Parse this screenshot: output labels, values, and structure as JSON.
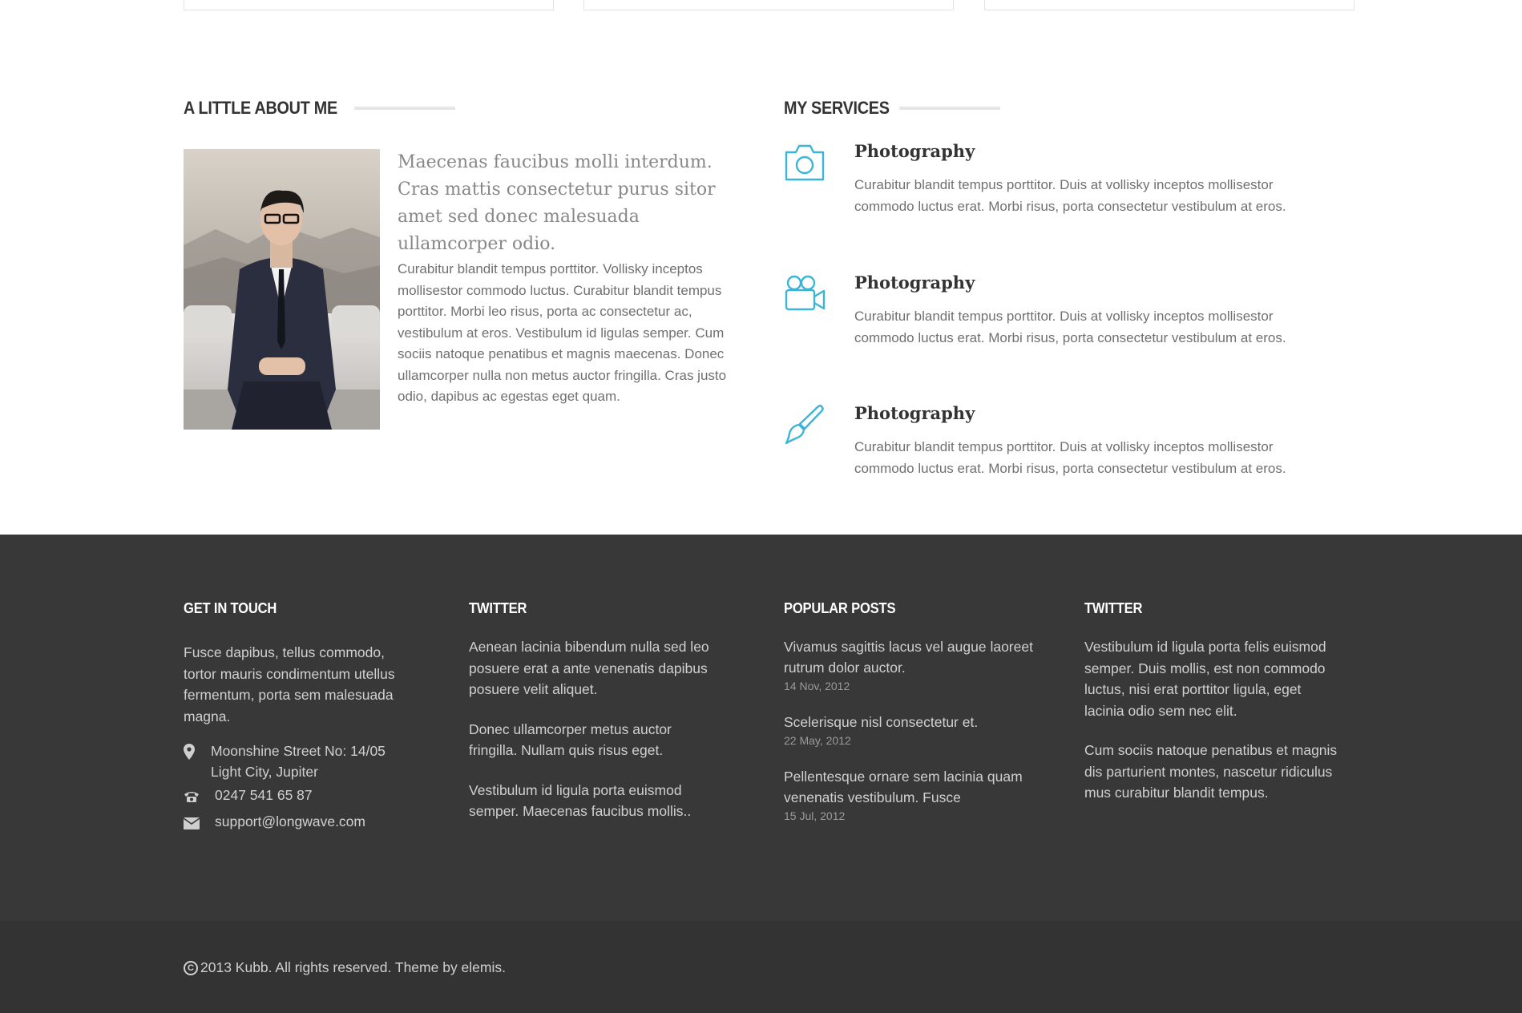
{
  "about": {
    "heading": "A LITTLE ABOUT ME",
    "lead": "Maecenas faucibus molli interdum. Cras mattis consectetur purus sitor amet sed donec malesuada ullamcorper odio.",
    "body": "Curabitur blandit tempus porttitor. Vollisky inceptos mollisestor commodo luctus. Curabitur blandit tempus porttitor. Morbi leo risus, porta ac consectetur ac, vestibulum at eros. Vestibulum id ligulas semper. Cum sociis natoque penatibus et magnis maecenas. Donec ullamcorper nulla non metus auctor fringilla. Cras justo odio, dapibus ac egestas eget quam."
  },
  "services": {
    "heading": "MY SERVICES",
    "accent_color": "#3cb4d8",
    "items": [
      {
        "icon": "camera-icon",
        "title": "Photography",
        "text": "Curabitur blandit tempus porttitor. Duis at vollisky inceptos mollisestor commodo luctus erat. Morbi risus, porta consectetur vestibulum at eros."
      },
      {
        "icon": "video-camera-icon",
        "title": "Photography",
        "text": "Curabitur blandit tempus porttitor. Duis at vollisky inceptos mollisestor commodo luctus erat. Morbi risus, porta consectetur vestibulum at eros."
      },
      {
        "icon": "paint-brush-icon",
        "title": "Photography",
        "text": "Curabitur blandit tempus porttitor. Duis at vollisky inceptos mollisestor commodo luctus erat. Morbi risus, porta consectetur vestibulum at eros."
      }
    ]
  },
  "footer": {
    "contact": {
      "heading": "GET IN TOUCH",
      "intro": "Fusce dapibus, tellus commodo, tortor mauris condimentum utellus fermentum, porta sem malesuada magna.",
      "address_line1": "Moonshine Street No: 14/05",
      "address_line2": "Light City, Jupiter",
      "phone": "0247 541 65 87",
      "email": "support@longwave.com"
    },
    "twitter1": {
      "heading": "TWITTER",
      "tweets": [
        "Aenean lacinia bibendum nulla sed leo posuere erat a ante venenatis dapibus posuere velit aliquet.",
        "Donec ullamcorper metus auctor fringilla. Nullam quis risus eget.",
        "Vestibulum id ligula porta euismod semper. Maecenas faucibus mollis.."
      ]
    },
    "posts": {
      "heading": "POPULAR POSTS",
      "items": [
        {
          "title": "Vivamus sagittis lacus vel augue laoreet rutrum dolor auctor.",
          "date": "14 Nov, 2012"
        },
        {
          "title": "Scelerisque nisl consectetur et.",
          "date": "22 May, 2012"
        },
        {
          "title": "Pellentesque ornare sem lacinia quam venenatis vestibulum. Fusce",
          "date": "15 Jul, 2012"
        }
      ]
    },
    "twitter2": {
      "heading": "TWITTER",
      "tweets": [
        "Vestibulum id ligula porta felis euismod semper. Duis mollis, est non commodo luctus, nisi erat porttitor ligula, eget lacinia odio sem nec elit.",
        "Cum sociis natoque penatibus et magnis dis parturient montes, nascetur ridiculus mus curabitur blandit tempus."
      ]
    },
    "copyright": "2013 Kubb. All rights reserved. Theme by elemis."
  }
}
